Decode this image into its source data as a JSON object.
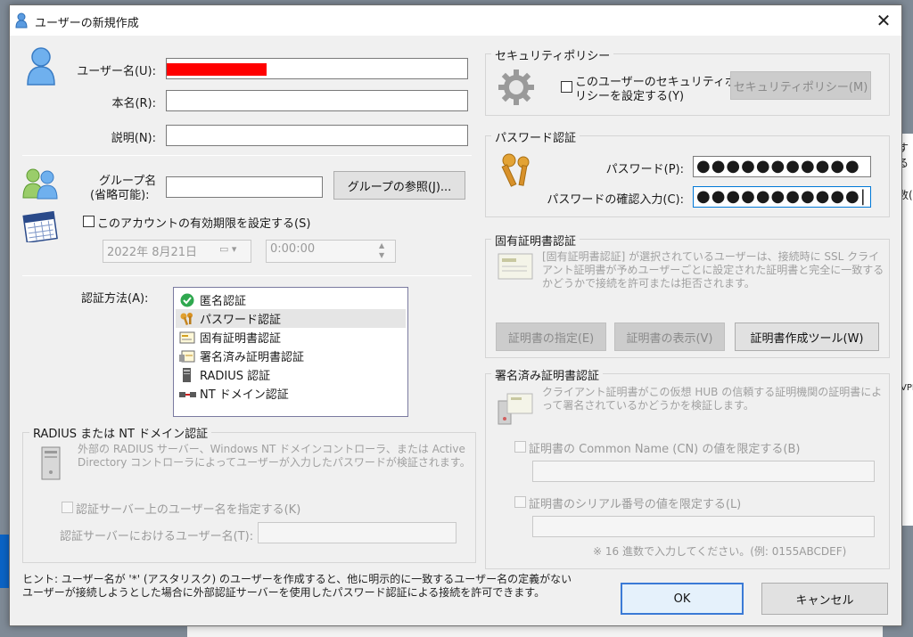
{
  "window": {
    "title": "ユーザーの新規作成",
    "close_glyph": "✕"
  },
  "user": {
    "username_label": "ユーザー名(U):",
    "username_value": "",
    "realname_label": "本名(R):",
    "realname_value": "",
    "desc_label": "説明(N):",
    "desc_value": ""
  },
  "group": {
    "label": "グループ名",
    "label_sub": "(省略可能):",
    "value": "",
    "browse_button": "グループの参照(J)..."
  },
  "expiry": {
    "checkbox_label": "このアカウントの有効期限を設定する(S)",
    "checked": false,
    "date": "2022年  8月21日",
    "time": "0:00:00"
  },
  "auth": {
    "label": "認証方法(A):",
    "methods": [
      "匿名認証",
      "パスワード認証",
      "固有証明書認証",
      "署名済み証明書認証",
      "RADIUS 認証",
      "NT ドメイン認証"
    ],
    "selected_index": 1
  },
  "radius": {
    "title": "RADIUS または NT ドメイン認証",
    "description": "外部の RADIUS サーバー、Windows NT ドメインコントローラ、または Active Directory コントローラによってユーザーが入力したパスワードが検証されます。",
    "checkbox_label": "認証サーバー上のユーザー名を指定する(K)",
    "username_label": "認証サーバーにおけるユーザー名(T):",
    "username_value": ""
  },
  "security_policy": {
    "title": "セキュリティポリシー",
    "checkbox_label_1": "このユーザーのセキュリティポ",
    "checkbox_label_2": "リシーを設定する(Y)",
    "button": "セキュリティポリシー(M)"
  },
  "password_auth": {
    "title": "パスワード認証",
    "password_label": "パスワード(P):",
    "password_value": "●●●●●●●●●●●",
    "confirm_label": "パスワードの確認入力(C):",
    "confirm_value": "●●●●●●●●●●●|"
  },
  "cert_auth": {
    "title": "固有証明書認証",
    "description": "[固有証明書認証] が選択されているユーザーは、接続時に SSL クライアント証明書が予めユーザーごとに設定された証明書と完全に一致するかどうかで接続を許可または拒否されます。",
    "specify_button": "証明書の指定(E)",
    "view_button": "証明書の表示(V)",
    "tool_button": "証明書作成ツール(W)"
  },
  "signed_cert": {
    "title": "署名済み証明書認証",
    "description": "クライアント証明書がこの仮想 HUB の信頼する証明機関の証明書によって署名されているかどうかを検証します。",
    "cn_checkbox": "証明書の Common Name (CN) の値を限定する(B)",
    "cn_value": "",
    "serial_checkbox": "証明書のシリアル番号の値を限定する(L)",
    "serial_value": "",
    "serial_hint": "※ 16 進数で入力してください。(例: 0155ABCDEF)"
  },
  "hint": {
    "line1": "ヒント: ユーザー名が '*' (アスタリスク) のユーザーを作成すると、他に明示的に一致するユーザー名の定義がない",
    "line2": "ユーザーが接続しようとした場合に外部認証サーバーを使用したパスワード認証による接続を許可できます。"
  },
  "buttons": {
    "ok": "OK",
    "cancel": "キャンセル"
  },
  "background": {
    "text_1": "する",
    "text_2": "数(",
    "text_3": "VPN"
  },
  "colors": {
    "accent": "#0078d7",
    "redaction": "#ff0000",
    "dialog_bg": "#f0f0f0"
  }
}
